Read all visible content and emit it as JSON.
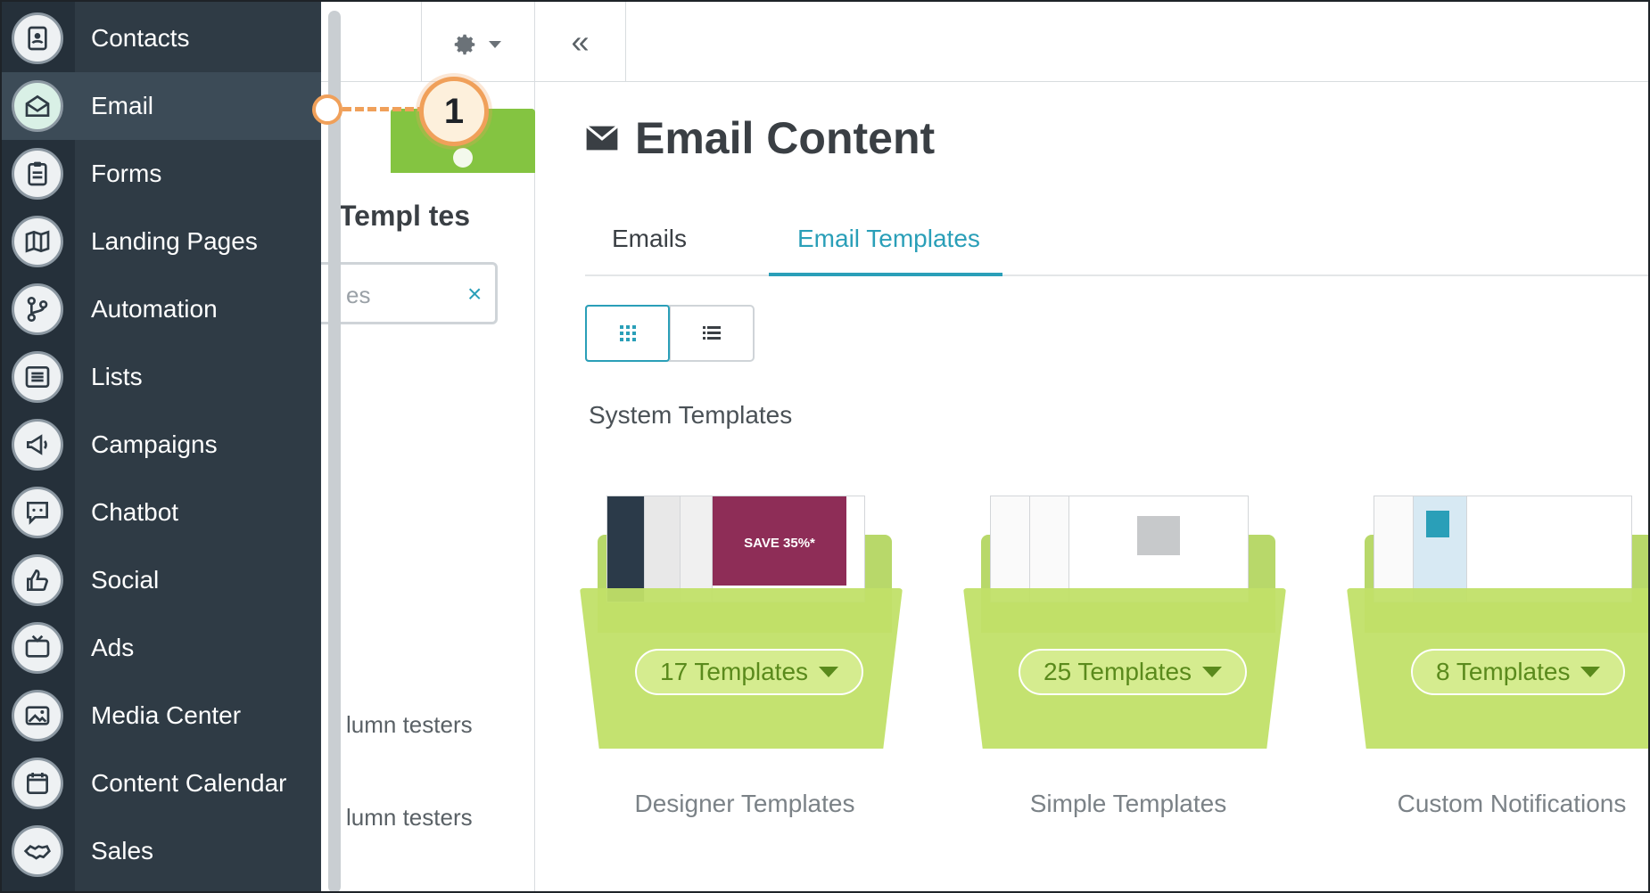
{
  "sidebar": {
    "items": [
      {
        "label": "Contacts",
        "icon": "contacts-book-icon"
      },
      {
        "label": "Email",
        "icon": "envelope-open-icon"
      },
      {
        "label": "Forms",
        "icon": "clipboard-icon"
      },
      {
        "label": "Landing Pages",
        "icon": "map-icon"
      },
      {
        "label": "Automation",
        "icon": "branch-icon"
      },
      {
        "label": "Lists",
        "icon": "list-icon"
      },
      {
        "label": "Campaigns",
        "icon": "megaphone-icon"
      },
      {
        "label": "Chatbot",
        "icon": "chat-bubble-icon"
      },
      {
        "label": "Social",
        "icon": "thumbs-up-icon"
      },
      {
        "label": "Ads",
        "icon": "tv-icon"
      },
      {
        "label": "Media Center",
        "icon": "image-gallery-icon"
      },
      {
        "label": "Content Calendar",
        "icon": "calendar-icon"
      },
      {
        "label": "Sales",
        "icon": "handshake-icon"
      }
    ],
    "active": "Email"
  },
  "callout": {
    "number": "1"
  },
  "mid_panel": {
    "heading": "Templ   tes",
    "search_text": "es",
    "search_clear": "×",
    "item_1": "lumn testers",
    "item_2": "lumn testers"
  },
  "main": {
    "collapse_glyph": "«",
    "title": "Email Content",
    "tabs": [
      {
        "label": "Emails",
        "active": false
      },
      {
        "label": "Email Templates",
        "active": true
      }
    ],
    "section_label": "System Templates",
    "folders": [
      {
        "count_label": "17 Templates",
        "name": "Designer Templates"
      },
      {
        "count_label": "25 Templates",
        "name": "Simple Templates"
      },
      {
        "count_label": "8 Templates",
        "name": "Custom Notifications"
      }
    ],
    "sale_text": "SAVE 35%*"
  },
  "colors": {
    "accent": "#2a9fb8",
    "sidebar_bg": "#2f3b45",
    "callout": "#f0a05a",
    "folder_green": "#c1e068"
  }
}
